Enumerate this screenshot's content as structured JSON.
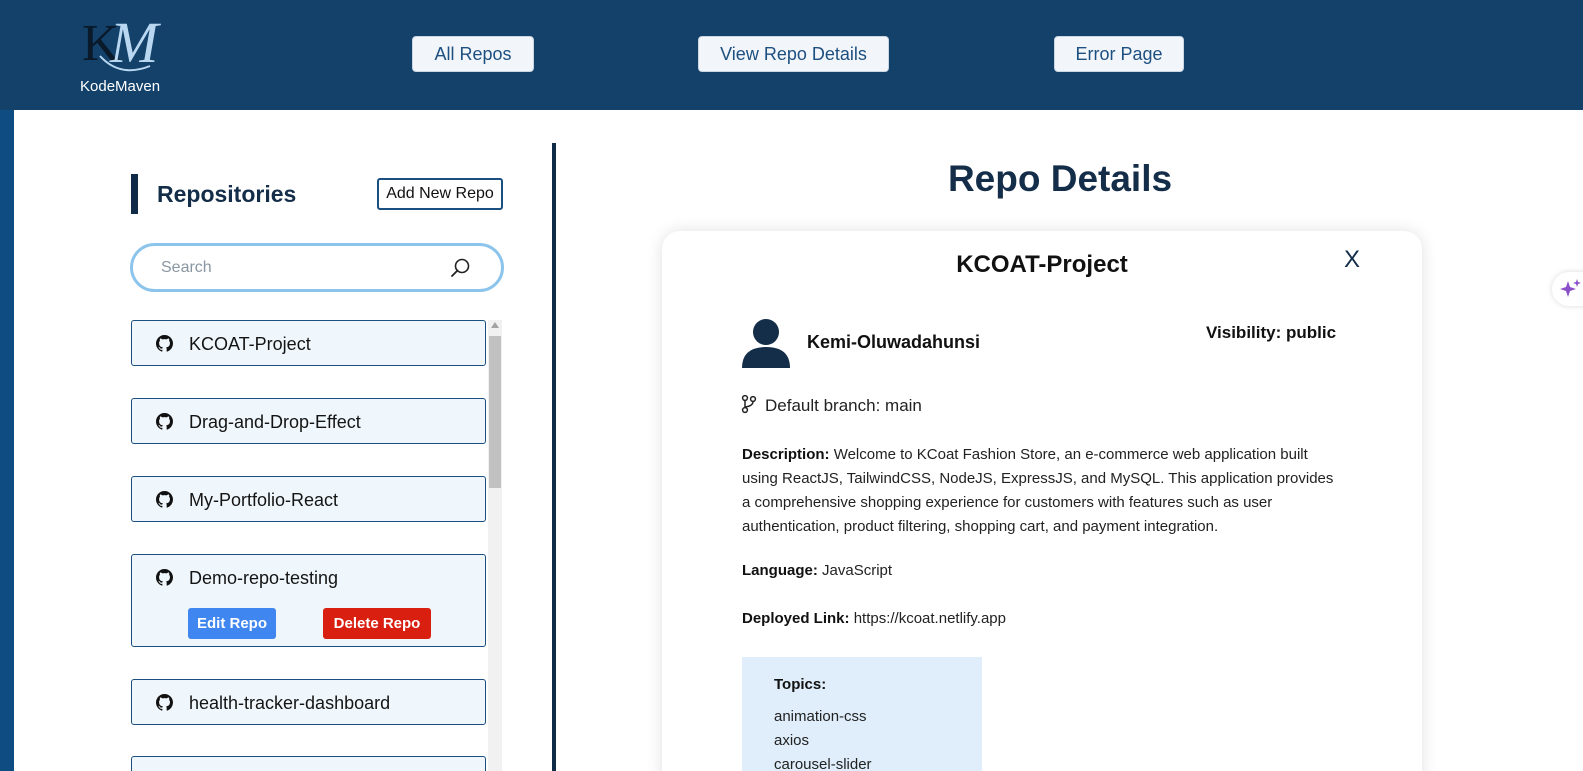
{
  "header": {
    "logo_text": "KodeMaven",
    "nav": [
      {
        "label": "All Repos"
      },
      {
        "label": "View Repo Details"
      },
      {
        "label": "Error Page"
      }
    ]
  },
  "sidebar": {
    "title": "Repositories",
    "add_button": "Add New Repo",
    "search_placeholder": "Search",
    "repos": [
      {
        "name": "KCOAT-Project"
      },
      {
        "name": "Drag-and-Drop-Effect"
      },
      {
        "name": "My-Portfolio-React"
      },
      {
        "name": "Demo-repo-testing",
        "edit_label": "Edit Repo",
        "delete_label": "Delete Repo"
      },
      {
        "name": "health-tracker-dashboard"
      }
    ]
  },
  "details": {
    "page_title": "Repo Details",
    "repo_name": "KCOAT-Project",
    "close_symbol": "X",
    "owner": "Kemi-Oluwadahunsi",
    "visibility_label": "Visibility:",
    "visibility": "public",
    "branch_label": "Default branch:",
    "branch": "main",
    "description_label": "Description:",
    "description": "Welcome to KCoat Fashion Store, an e-commerce web application built using ReactJS, TailwindCSS, NodeJS, ExpressJS, and MySQL. This application provides a comprehensive shopping experience for customers with features such as user authentication, product filtering, shopping cart, and payment integration.",
    "language_label": "Language:",
    "language": "JavaScript",
    "deployed_label": "Deployed Link:",
    "deployed_link": "https://kcoat.netlify.app",
    "topics_label": "Topics:",
    "topics": [
      "animation-css",
      "axios",
      "carousel-slider"
    ]
  },
  "colors": {
    "header_bg": "#134169",
    "accent_dark": "#142d48",
    "edit_button": "#3f86f0",
    "delete_button": "#d91f10",
    "list_border": "#1b4f82"
  }
}
